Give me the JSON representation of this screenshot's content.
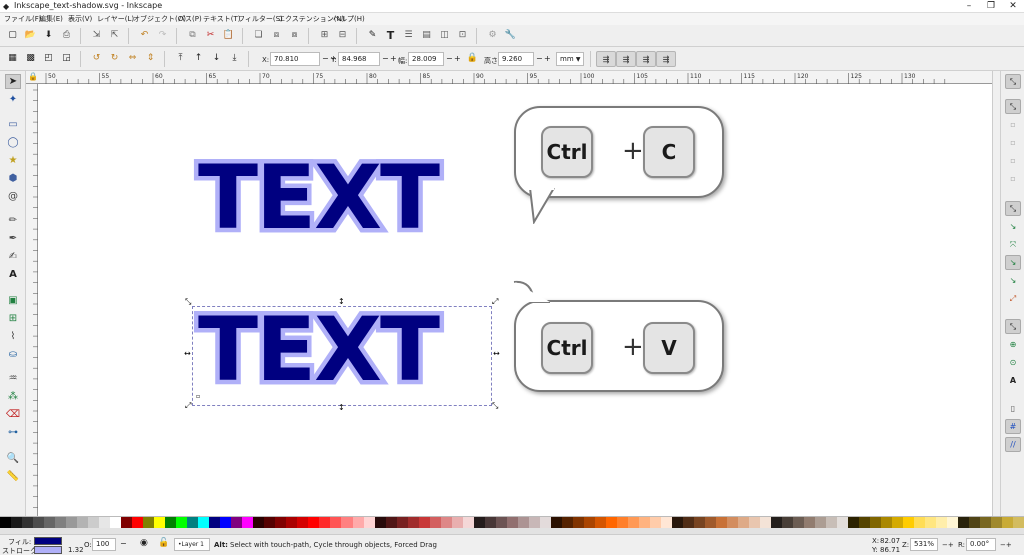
{
  "window": {
    "title": "Inkscape_text-shadow.svg - Inkscape"
  },
  "menu": [
    "ファイル(F)",
    "編集(E)",
    "表示(V)",
    "レイヤー(L)",
    "オブジェクト(O)",
    "パス(P)",
    "テキスト(T)",
    "フィルター(S)",
    "エクステンション(N)",
    "ヘルプ(H)"
  ],
  "controls": {
    "x_label": "X:",
    "x_value": "70.810",
    "y_label": "Y:",
    "y_value": "84.968",
    "w_label": "幅:",
    "w_value": "28.009",
    "h_label": "高さ:",
    "h_value": "9.260",
    "unit": "mm"
  },
  "ruler": {
    "ticks": [
      "50",
      "55",
      "60",
      "65",
      "70",
      "75",
      "80",
      "85",
      "90",
      "95",
      "100",
      "105",
      "110",
      "115",
      "120",
      "125",
      "130"
    ]
  },
  "canvas": {
    "text_top": "TEXT",
    "text_bottom": "TEXT",
    "bubble_top": {
      "key1": "Ctrl",
      "plus": "+",
      "key2": "C"
    },
    "bubble_bottom": {
      "key1": "Ctrl",
      "plus": "+",
      "key2": "V"
    }
  },
  "status": {
    "fill_label": "フィル:",
    "stroke_label": "ストローク:",
    "fill_color": "#000080",
    "stroke_color": "#b0b0f8",
    "stroke_width": "1.32",
    "opacity_label": "O:",
    "opacity_value": "100",
    "layer": "•Layer 1",
    "message_key": "Alt:",
    "message": "Select with touch-path, Cycle through objects, Forced Drag",
    "cx_label": "X:",
    "cx_value": "82.07",
    "cy_label": "Y:",
    "cy_value": "86.71",
    "zoom_label": "Z:",
    "zoom_value": "531%",
    "rot_label": "R:",
    "rot_value": "0.00°"
  },
  "palette_colors": [
    "#000000",
    "#1a1a1a",
    "#333333",
    "#4d4d4d",
    "#666666",
    "#808080",
    "#999999",
    "#b3b3b3",
    "#cccccc",
    "#e6e6e6",
    "#ffffff",
    "#800000",
    "#ff0000",
    "#808000",
    "#ffff00",
    "#008000",
    "#00ff00",
    "#008080",
    "#00ffff",
    "#000080",
    "#0000ff",
    "#800080",
    "#ff00ff",
    "#2b0000",
    "#550000",
    "#800000",
    "#aa0000",
    "#d40000",
    "#ff0000",
    "#ff2a2a",
    "#ff5555",
    "#ff8080",
    "#ffaaaa",
    "#ffd5d5",
    "#280b0b",
    "#501616",
    "#782121",
    "#a02c2c",
    "#c83737",
    "#d35f5f",
    "#de8787",
    "#e9afaf",
    "#f4d7d7",
    "#241c1c",
    "#483737",
    "#6c5353",
    "#916f6f",
    "#ac9393",
    "#c8b7b7",
    "#e3dbdb",
    "#2b1100",
    "#552200",
    "#803300",
    "#aa4400",
    "#d45500",
    "#ff6600",
    "#ff7f2a",
    "#ff9955",
    "#ffb380",
    "#ffccaa",
    "#ffe6d5",
    "#28170b",
    "#502d16",
    "#784421",
    "#a05a2c",
    "#c87137",
    "#d38d5f",
    "#deaa87",
    "#e9c6af",
    "#f4e3d7",
    "#241f1c",
    "#483e37",
    "#6c5d53",
    "#917c6f",
    "#ac9d93",
    "#c8beb7",
    "#e3dedb",
    "#2b2200",
    "#554400",
    "#806600",
    "#aa8800",
    "#d4aa00",
    "#ffcc00",
    "#ffdd55",
    "#ffe680",
    "#ffeeaa",
    "#fff6d5",
    "#28220b",
    "#504416",
    "#786721",
    "#a0892c",
    "#c8ab37",
    "#d3bc5f"
  ]
}
